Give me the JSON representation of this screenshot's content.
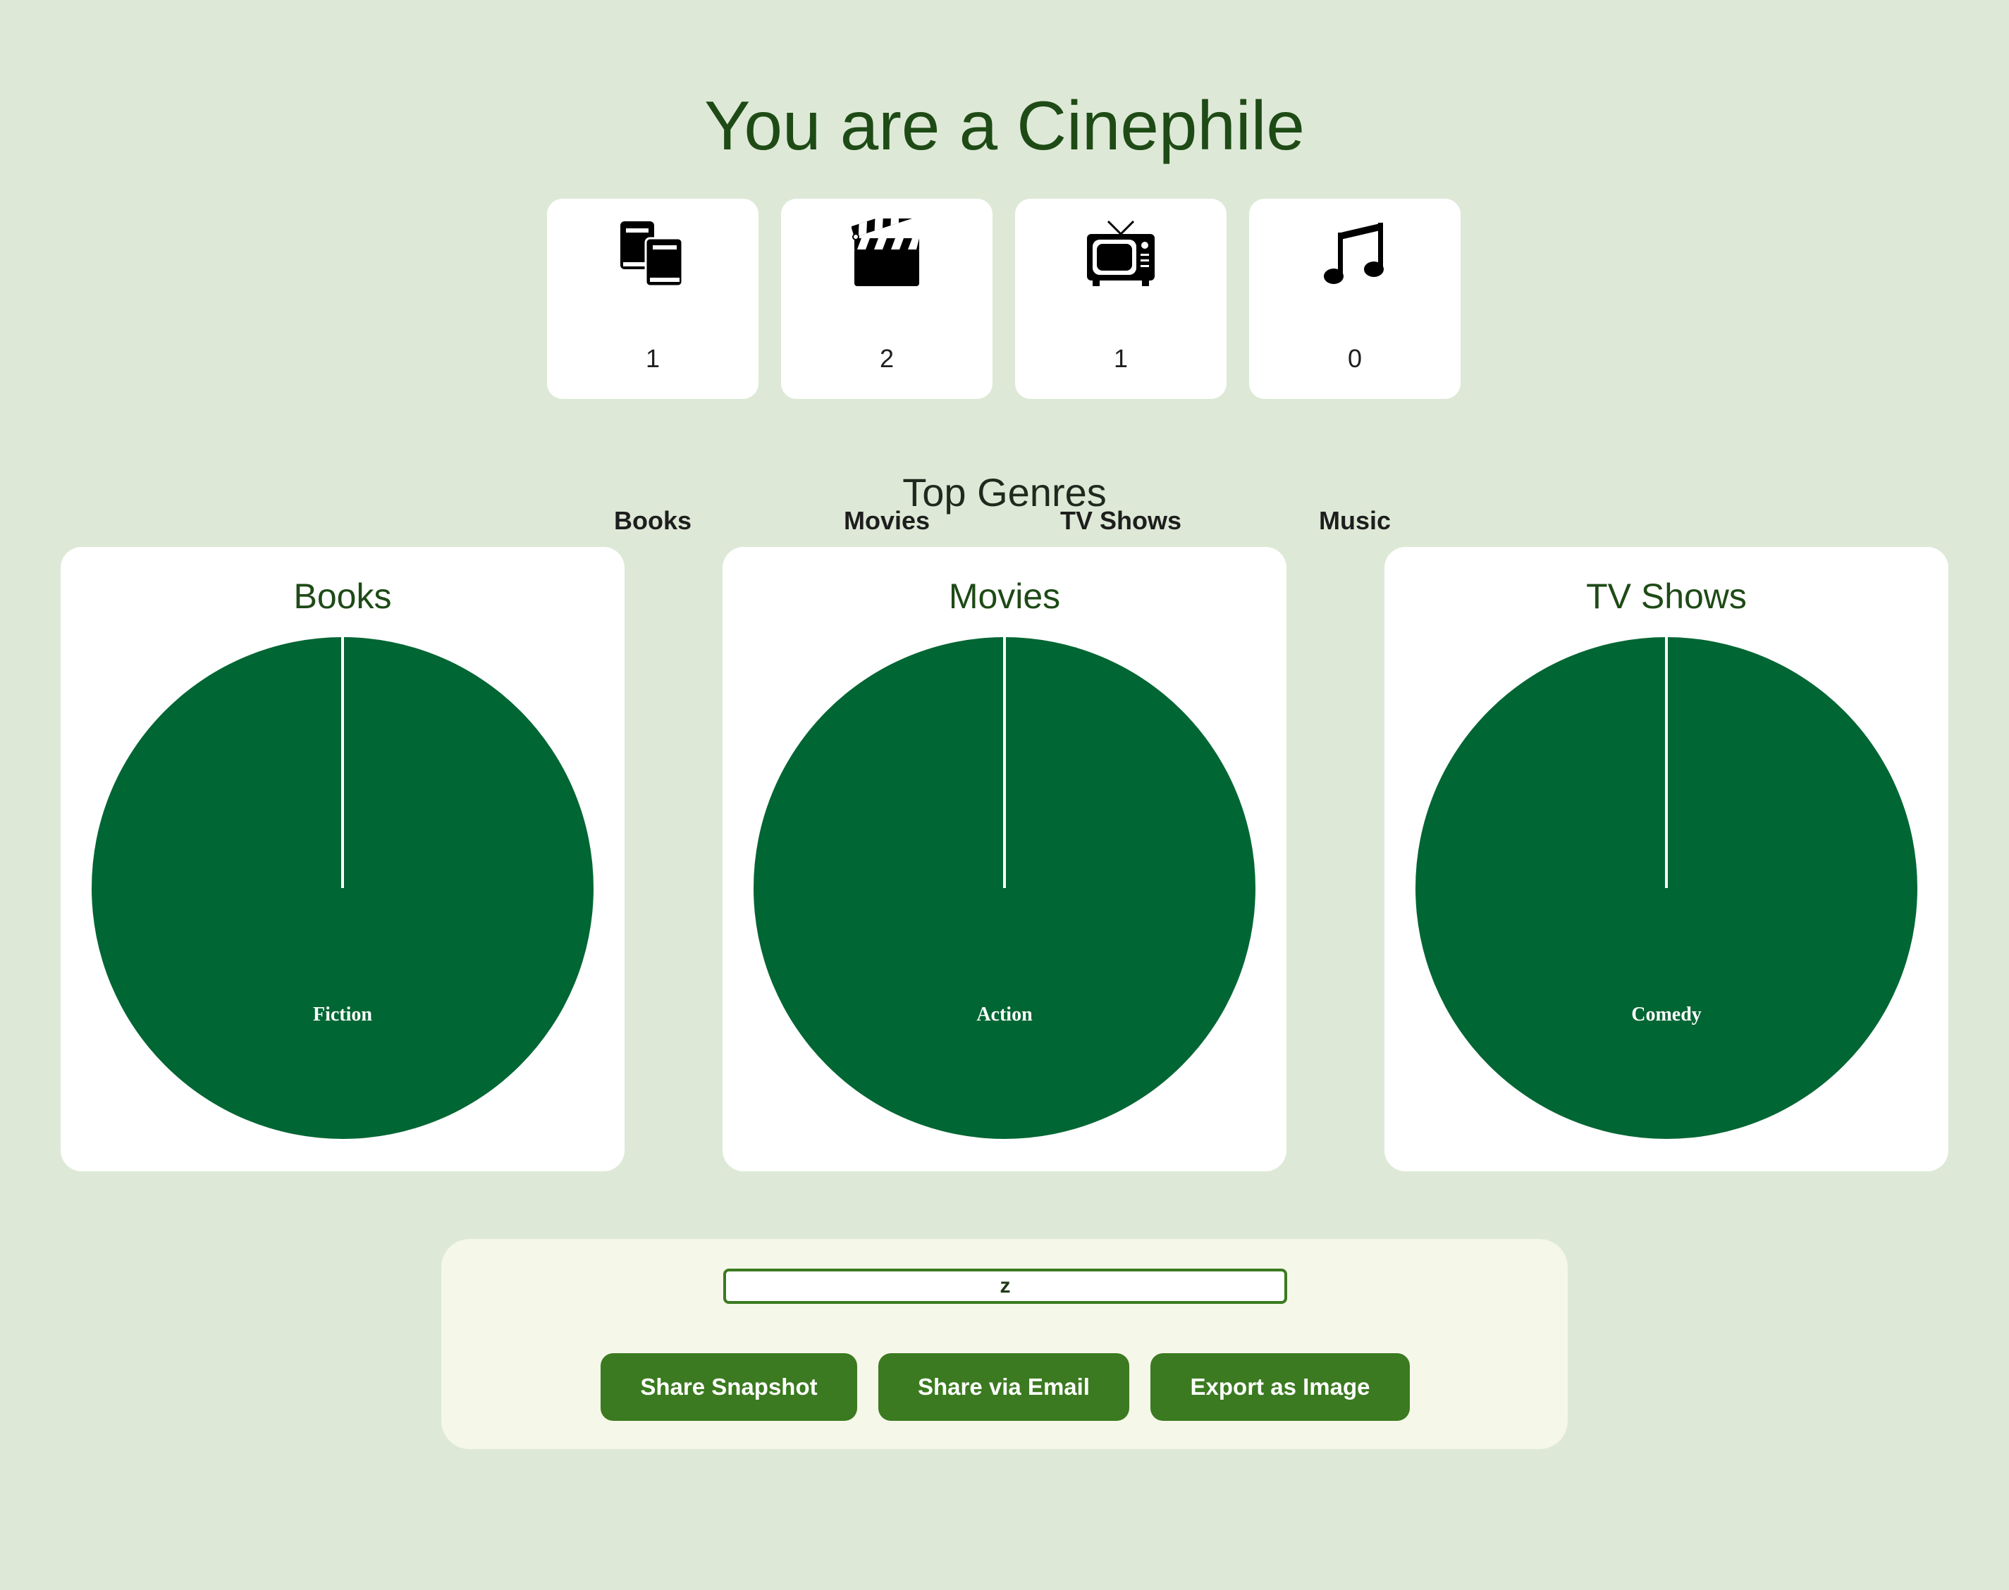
{
  "page": {
    "title": "You are a Cinephile",
    "section_title": "Top Genres"
  },
  "counts": [
    {
      "label": "Books",
      "value": "1",
      "icon": "books-icon"
    },
    {
      "label": "Movies",
      "value": "2",
      "icon": "clapperboard-icon"
    },
    {
      "label": "TV Shows",
      "value": "1",
      "icon": "television-icon"
    },
    {
      "label": "Music",
      "value": "0",
      "icon": "music-note-icon"
    }
  ],
  "colors": {
    "background": "#dde9d6",
    "pie_fill": "#006633",
    "accent": "#3b7a20",
    "heading": "#1e4a16",
    "panel": "#f5f7e8"
  },
  "chart_data": [
    {
      "type": "pie",
      "title": "Books",
      "labels": [
        "Fiction"
      ],
      "values": [
        1
      ]
    },
    {
      "type": "pie",
      "title": "Movies",
      "labels": [
        "Action"
      ],
      "values": [
        2
      ]
    },
    {
      "type": "pie",
      "title": "TV Shows",
      "labels": [
        "Comedy"
      ],
      "values": [
        1
      ]
    }
  ],
  "share": {
    "input_value": "z",
    "buttons": [
      "Share Snapshot",
      "Share via Email",
      "Export as Image"
    ]
  }
}
